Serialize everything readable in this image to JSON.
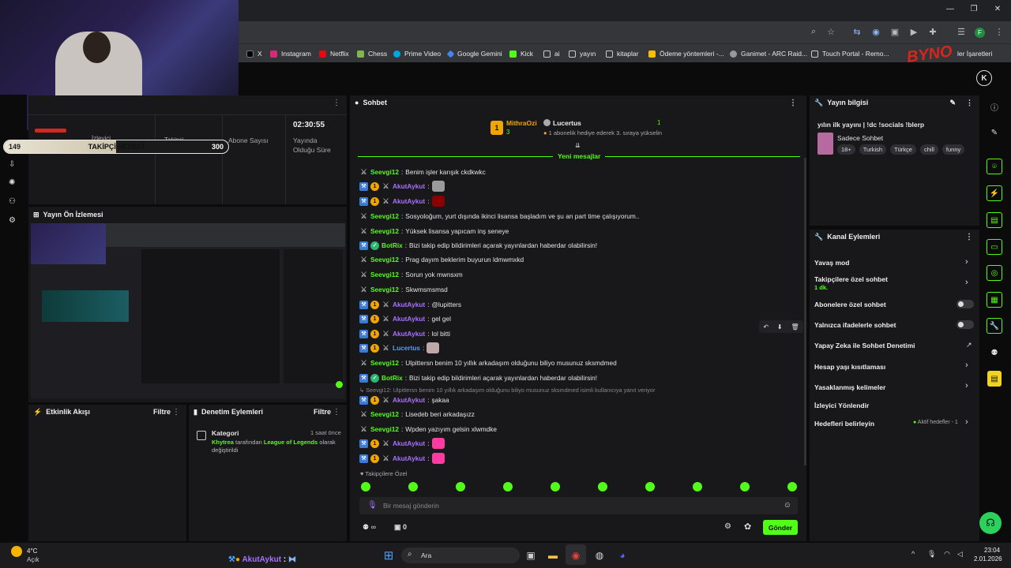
{
  "browser": {
    "bookmarks": [
      "X",
      "Instagram",
      "Netflix",
      "Chess",
      "Prime Video",
      "Google Gemini",
      "Kick",
      "ai",
      "yayın",
      "kitaplar",
      "Ödeme yöntemleri -...",
      "Ganimet - ARC Raid...",
      "Touch Portal - Remo...",
      "ler İşaretleri"
    ],
    "profile_initial": "F"
  },
  "overlay": {
    "follower_goal_current": "149",
    "follower_goal_label": "TAKİPÇİ HEDEFİ",
    "follower_goal_target": "300",
    "follower_goal_progress": 0.5,
    "logo_text": "BYNO"
  },
  "stats": {
    "label1": "İzleyici",
    "label2": "Takipçi",
    "label3": "Abone Sayısı",
    "uptime": "02:30:55",
    "uptime_label": "Yayında Olduğu Süre"
  },
  "preview": {
    "title": "Yayın Ön İzlemesi"
  },
  "activity": {
    "title": "Etkinlik Akışı",
    "filter": "Filtre"
  },
  "moderation": {
    "title": "Denetim Eylemleri",
    "filter": "Filtre",
    "item_title": "Kategori",
    "item_time": "1 saat önce",
    "item_user": "Khytrea",
    "item_text1": " tarafından ",
    "item_cat": "League of Legends",
    "item_text2": " olarak",
    "item_text3": "değiştirildi"
  },
  "chat": {
    "title": "Sohbet",
    "pinned_user1": "MithraOzi",
    "pinned_count1": "3",
    "pinned_user2": "Lucertus",
    "pinned_count2": "1",
    "pinned_text": "1 abonelik hediye ederek 3. sıraya yükselin",
    "new_messages": "Yeni mesajlar",
    "messages": [
      {
        "user": "Seevgi12",
        "text": "Benim işler karışık ckdkwkc"
      },
      {
        "user": "AkutAykut",
        "text": ""
      },
      {
        "user": "AkutAykut",
        "text": ""
      },
      {
        "user": "Seevgi12",
        "text": "Sosyoloğum, yurt dışında ikinci lisansa başladım ve şu an part time çalışıyorum.."
      },
      {
        "user": "Seevgi12",
        "text": "Yüksek lisansa yapıcam inş seneye"
      },
      {
        "user": "BotRix",
        "text": "Bizi takip edip bildirimleri açarak yayınlardan haberdar olabilirsin!"
      },
      {
        "user": "Seevgi12",
        "text": "Prag dayım beklerim buyurun ldmwmxkd"
      },
      {
        "user": "Seevgi12",
        "text": "Sorun yok mwnsxm"
      },
      {
        "user": "Seevgi12",
        "text": "Skwmsmsmsd"
      },
      {
        "user": "AkutAykut",
        "text": "@lupitters"
      },
      {
        "user": "AkutAykut",
        "text": "gel gel"
      },
      {
        "user": "AkutAykut",
        "text": "lol bitti"
      },
      {
        "user": "Lucertus",
        "text": ""
      },
      {
        "user": "Seevgi12",
        "text": "Ulpittersn benim 10 yıllık arkadaşım olduğunu biliyo musunuz sksmdmed"
      },
      {
        "user": "BotRix",
        "text": "Bizi takip edip bildirimleri açarak yayınlardan haberdar olabilirsin!"
      },
      {
        "user": "AkutAykut",
        "text": "şakaa"
      },
      {
        "user": "Seevgi12",
        "text": "Lisedeb beri arkadaşızz"
      },
      {
        "user": "Seevgi12",
        "text": "Wpden yazıyım gelsin xlwmdke"
      },
      {
        "user": "AkutAykut",
        "text": ""
      },
      {
        "user": "AkutAykut",
        "text": ""
      }
    ],
    "reply_note": "Seevgi12: Ulpittersn benim 10 yıllık arkadaşım olduğunu biliyo musunuz sksmdmed isimli kullanıcıya yanıt veriyor",
    "followers_only": "Takipçilere Özel",
    "input_placeholder": "Bir mesaj gönderin",
    "infinity": "∞",
    "count": "0",
    "send": "Gönder"
  },
  "stream_info": {
    "title": "Yayın bilgisi",
    "stream_title": "yılın ilk yayını | !dc !socials !blerp",
    "category": "Sadece Sohbet",
    "tags": [
      "18+",
      "Turkish",
      "Türkçe",
      "chill",
      "funny"
    ]
  },
  "channel_actions": {
    "title": "Kanal Eylemleri",
    "slow_mode": "Yavaş mod",
    "followers_chat": "Takipçilere özel sohbet",
    "followers_chat_sub": "1 dk.",
    "subs_chat": "Abonelere özel sohbet",
    "emote_chat": "Yalnızca ifadelerle sohbet",
    "ai_moderation": "Yapay Zeka ile Sohbet Denetimi",
    "age_limit": "Hesap yaşı kısıtlaması",
    "banned_words": "Yasaklanmış kelimeler",
    "redirect": "İzleyici Yönlendir",
    "goals": "Hedefleri belirleyin",
    "goals_status": "Aktif hedefler - 1"
  },
  "taskbar": {
    "temp": "4°C",
    "weather": "Açık",
    "ticker_user": "AkutAykut",
    "ticker_sep": ":",
    "search": "Ara",
    "time": "23:04",
    "date": "2.01.2026"
  },
  "colors": {
    "accent": "#53fc18",
    "bg": "#0b0b0c",
    "panel": "#18181b"
  }
}
